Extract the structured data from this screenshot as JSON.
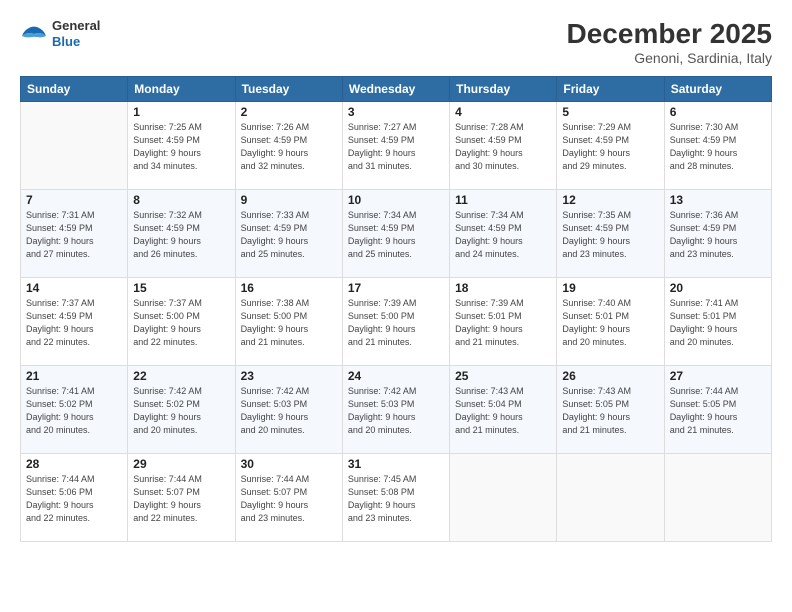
{
  "logo": {
    "general": "General",
    "blue": "Blue"
  },
  "header": {
    "month": "December 2025",
    "location": "Genoni, Sardinia, Italy"
  },
  "weekdays": [
    "Sunday",
    "Monday",
    "Tuesday",
    "Wednesday",
    "Thursday",
    "Friday",
    "Saturday"
  ],
  "weeks": [
    [
      {
        "day": "",
        "info": ""
      },
      {
        "day": "1",
        "info": "Sunrise: 7:25 AM\nSunset: 4:59 PM\nDaylight: 9 hours\nand 34 minutes."
      },
      {
        "day": "2",
        "info": "Sunrise: 7:26 AM\nSunset: 4:59 PM\nDaylight: 9 hours\nand 32 minutes."
      },
      {
        "day": "3",
        "info": "Sunrise: 7:27 AM\nSunset: 4:59 PM\nDaylight: 9 hours\nand 31 minutes."
      },
      {
        "day": "4",
        "info": "Sunrise: 7:28 AM\nSunset: 4:59 PM\nDaylight: 9 hours\nand 30 minutes."
      },
      {
        "day": "5",
        "info": "Sunrise: 7:29 AM\nSunset: 4:59 PM\nDaylight: 9 hours\nand 29 minutes."
      },
      {
        "day": "6",
        "info": "Sunrise: 7:30 AM\nSunset: 4:59 PM\nDaylight: 9 hours\nand 28 minutes."
      }
    ],
    [
      {
        "day": "7",
        "info": "Sunrise: 7:31 AM\nSunset: 4:59 PM\nDaylight: 9 hours\nand 27 minutes."
      },
      {
        "day": "8",
        "info": "Sunrise: 7:32 AM\nSunset: 4:59 PM\nDaylight: 9 hours\nand 26 minutes."
      },
      {
        "day": "9",
        "info": "Sunrise: 7:33 AM\nSunset: 4:59 PM\nDaylight: 9 hours\nand 25 minutes."
      },
      {
        "day": "10",
        "info": "Sunrise: 7:34 AM\nSunset: 4:59 PM\nDaylight: 9 hours\nand 25 minutes."
      },
      {
        "day": "11",
        "info": "Sunrise: 7:34 AM\nSunset: 4:59 PM\nDaylight: 9 hours\nand 24 minutes."
      },
      {
        "day": "12",
        "info": "Sunrise: 7:35 AM\nSunset: 4:59 PM\nDaylight: 9 hours\nand 23 minutes."
      },
      {
        "day": "13",
        "info": "Sunrise: 7:36 AM\nSunset: 4:59 PM\nDaylight: 9 hours\nand 23 minutes."
      }
    ],
    [
      {
        "day": "14",
        "info": "Sunrise: 7:37 AM\nSunset: 4:59 PM\nDaylight: 9 hours\nand 22 minutes."
      },
      {
        "day": "15",
        "info": "Sunrise: 7:37 AM\nSunset: 5:00 PM\nDaylight: 9 hours\nand 22 minutes."
      },
      {
        "day": "16",
        "info": "Sunrise: 7:38 AM\nSunset: 5:00 PM\nDaylight: 9 hours\nand 21 minutes."
      },
      {
        "day": "17",
        "info": "Sunrise: 7:39 AM\nSunset: 5:00 PM\nDaylight: 9 hours\nand 21 minutes."
      },
      {
        "day": "18",
        "info": "Sunrise: 7:39 AM\nSunset: 5:01 PM\nDaylight: 9 hours\nand 21 minutes."
      },
      {
        "day": "19",
        "info": "Sunrise: 7:40 AM\nSunset: 5:01 PM\nDaylight: 9 hours\nand 20 minutes."
      },
      {
        "day": "20",
        "info": "Sunrise: 7:41 AM\nSunset: 5:01 PM\nDaylight: 9 hours\nand 20 minutes."
      }
    ],
    [
      {
        "day": "21",
        "info": "Sunrise: 7:41 AM\nSunset: 5:02 PM\nDaylight: 9 hours\nand 20 minutes."
      },
      {
        "day": "22",
        "info": "Sunrise: 7:42 AM\nSunset: 5:02 PM\nDaylight: 9 hours\nand 20 minutes."
      },
      {
        "day": "23",
        "info": "Sunrise: 7:42 AM\nSunset: 5:03 PM\nDaylight: 9 hours\nand 20 minutes."
      },
      {
        "day": "24",
        "info": "Sunrise: 7:42 AM\nSunset: 5:03 PM\nDaylight: 9 hours\nand 20 minutes."
      },
      {
        "day": "25",
        "info": "Sunrise: 7:43 AM\nSunset: 5:04 PM\nDaylight: 9 hours\nand 21 minutes."
      },
      {
        "day": "26",
        "info": "Sunrise: 7:43 AM\nSunset: 5:05 PM\nDaylight: 9 hours\nand 21 minutes."
      },
      {
        "day": "27",
        "info": "Sunrise: 7:44 AM\nSunset: 5:05 PM\nDaylight: 9 hours\nand 21 minutes."
      }
    ],
    [
      {
        "day": "28",
        "info": "Sunrise: 7:44 AM\nSunset: 5:06 PM\nDaylight: 9 hours\nand 22 minutes."
      },
      {
        "day": "29",
        "info": "Sunrise: 7:44 AM\nSunset: 5:07 PM\nDaylight: 9 hours\nand 22 minutes."
      },
      {
        "day": "30",
        "info": "Sunrise: 7:44 AM\nSunset: 5:07 PM\nDaylight: 9 hours\nand 23 minutes."
      },
      {
        "day": "31",
        "info": "Sunrise: 7:45 AM\nSunset: 5:08 PM\nDaylight: 9 hours\nand 23 minutes."
      },
      {
        "day": "",
        "info": ""
      },
      {
        "day": "",
        "info": ""
      },
      {
        "day": "",
        "info": ""
      }
    ]
  ]
}
